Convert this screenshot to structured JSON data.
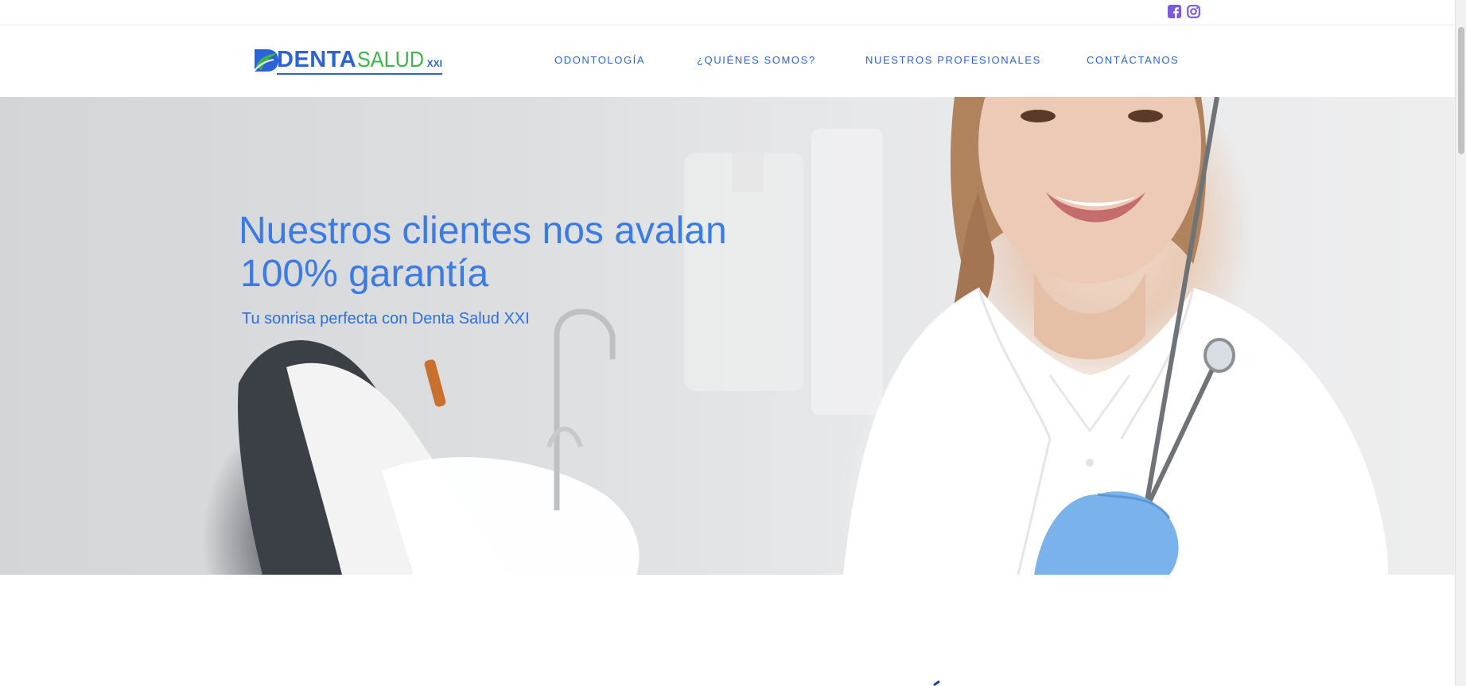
{
  "brand": {
    "logo_denta": "DENTA",
    "logo_salud": "SALUD",
    "logo_xxi": "XXI",
    "color_blue": "#2b63d6",
    "color_green": "#3fb548"
  },
  "social": {
    "facebook_icon": "facebook-square-icon",
    "instagram_icon": "instagram-icon",
    "icon_color": "#7b5bd8"
  },
  "nav": {
    "items": [
      {
        "label": "ODONTOLOGÍA"
      },
      {
        "label": "¿QUIÉNES SOMOS?"
      },
      {
        "label": "NUESTROS PROFESIONALES"
      },
      {
        "label": "CONTÁCTANOS"
      }
    ]
  },
  "hero": {
    "title_line1": "Nuestros clientes nos avalan",
    "title_line2": "100% garantía",
    "subtitle": "Tu sonrisa perfecta con Denta Salud XXI",
    "text_color": "#3a7be8"
  }
}
